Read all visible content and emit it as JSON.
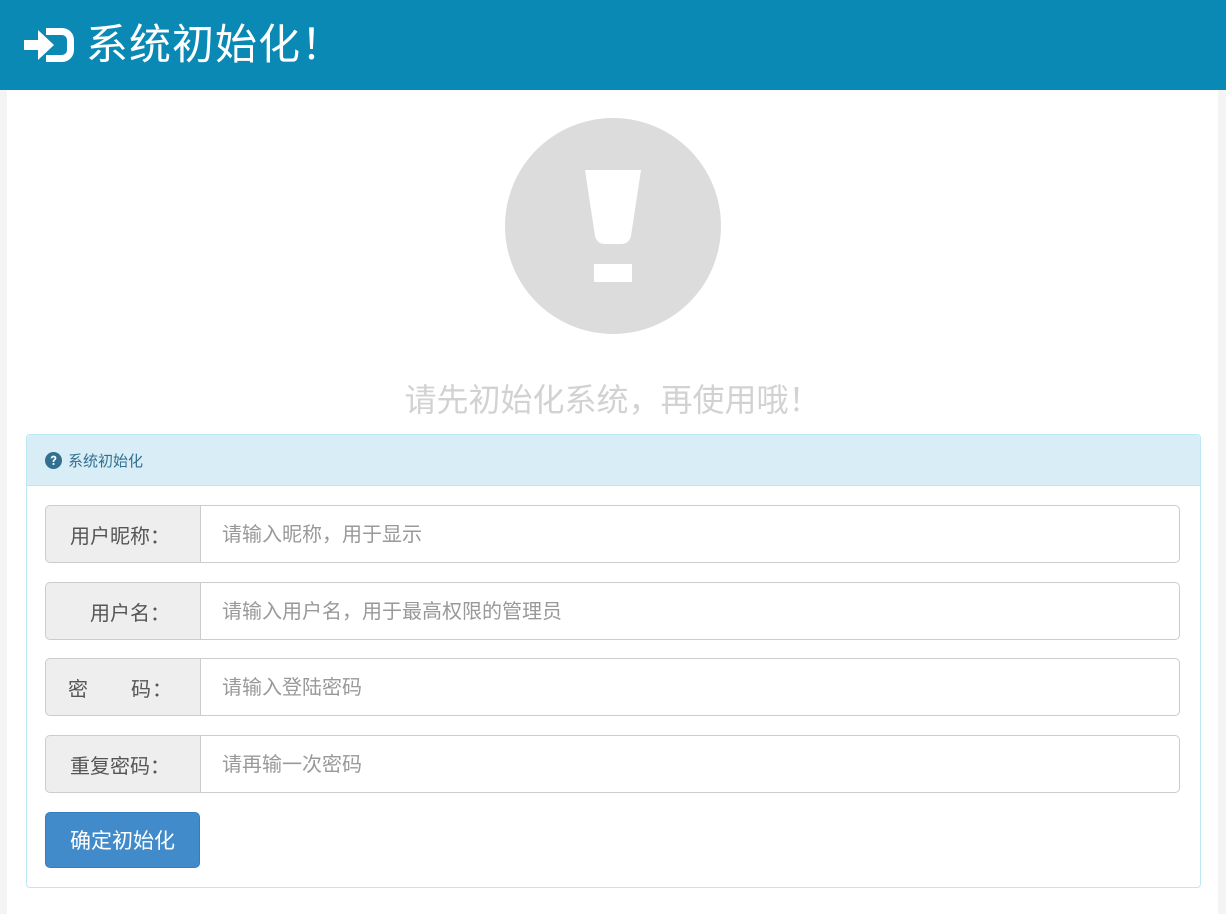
{
  "header": {
    "title": "系统初始化！",
    "icon": "sign-in-icon",
    "background": "#0a89b5"
  },
  "notice": {
    "icon": "exclamation-icon",
    "text": "请先初始化系统，再使用哦！"
  },
  "panel": {
    "title": "系统初始化",
    "icon": "question-circle-icon",
    "fields": [
      {
        "label": "用户昵称：",
        "placeholder": "请输入昵称，用于显示"
      },
      {
        "label": "用户名：",
        "placeholder": "请输入用户名，用于最高权限的管理员"
      },
      {
        "label": "密　　码：",
        "placeholder": "请输入登陆密码"
      },
      {
        "label": "重复密码：",
        "placeholder": "请再输一次密码"
      }
    ],
    "submit_label": "确定初始化"
  },
  "colors": {
    "primary": "#428bca",
    "panel_heading": "#d9edf7",
    "panel_text": "#31708f"
  }
}
